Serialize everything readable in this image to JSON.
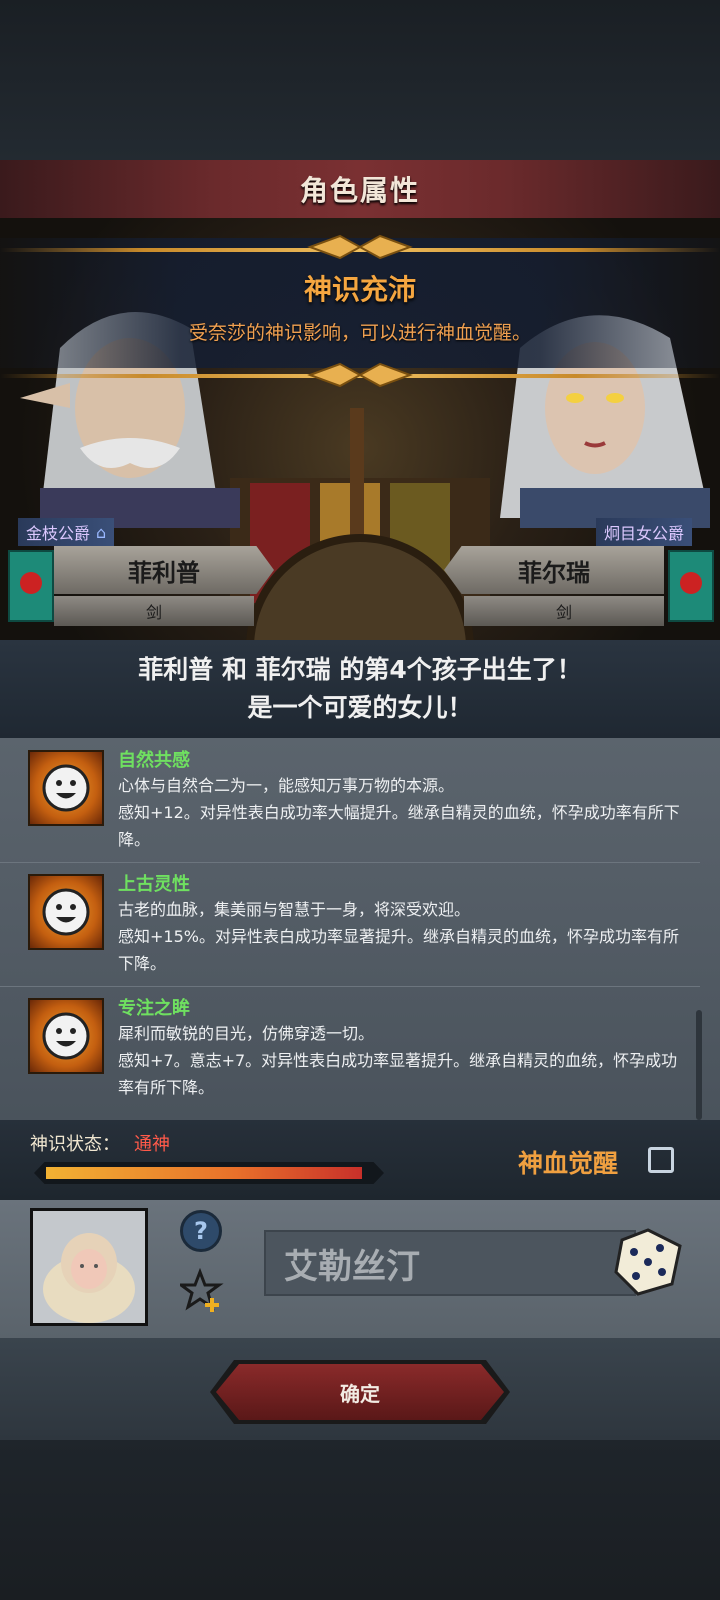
{
  "title": "角色属性",
  "banner": {
    "title": "神识充沛",
    "description": "受奈莎的神识影响，可以进行神血觉醒。"
  },
  "father": {
    "rank": "金枝公爵",
    "name": "菲利普",
    "weapon": "剑"
  },
  "mother": {
    "rank": "炯目女公爵",
    "name": "菲尔瑞",
    "weapon": "剑"
  },
  "announcement": {
    "line1": "菲利普 和 菲尔瑞 的第4个孩子出生了！",
    "line2": "是一个可爱的女儿！"
  },
  "traits": [
    {
      "name": "自然共感",
      "desc1": "心体与自然合二为一，能感知万事万物的本源。",
      "desc2": "感知+12。对异性表白成功率大幅提升。继承自精灵的血统，怀孕成功率有所下降。",
      "icon": "smiley-icon"
    },
    {
      "name": "上古灵性",
      "desc1": "古老的血脉，集美丽与智慧于一身，将深受欢迎。",
      "desc2": "感知+15%。对异性表白成功率显著提升。继承自精灵的血统，怀孕成功率有所下降。",
      "icon": "smiley-icon"
    },
    {
      "name": "专注之眸",
      "desc1": "犀利而敏锐的目光，仿佛穿透一切。",
      "desc2": "感知+7。意志+7。对异性表白成功率显著提升。继承自精灵的血统，怀孕成功率有所下降。",
      "icon": "smiley-icon"
    }
  ],
  "status": {
    "label": "神识状态：",
    "value": "通神",
    "progress": 0.97,
    "awaken_label": "神血觉醒",
    "awaken_checked": false
  },
  "child": {
    "name": "艾勒丝汀"
  },
  "confirm_label": "确定",
  "colors": {
    "accent_orange": "#f0a040",
    "trait_green": "#6fe060",
    "status_red": "#ff5a4a"
  }
}
